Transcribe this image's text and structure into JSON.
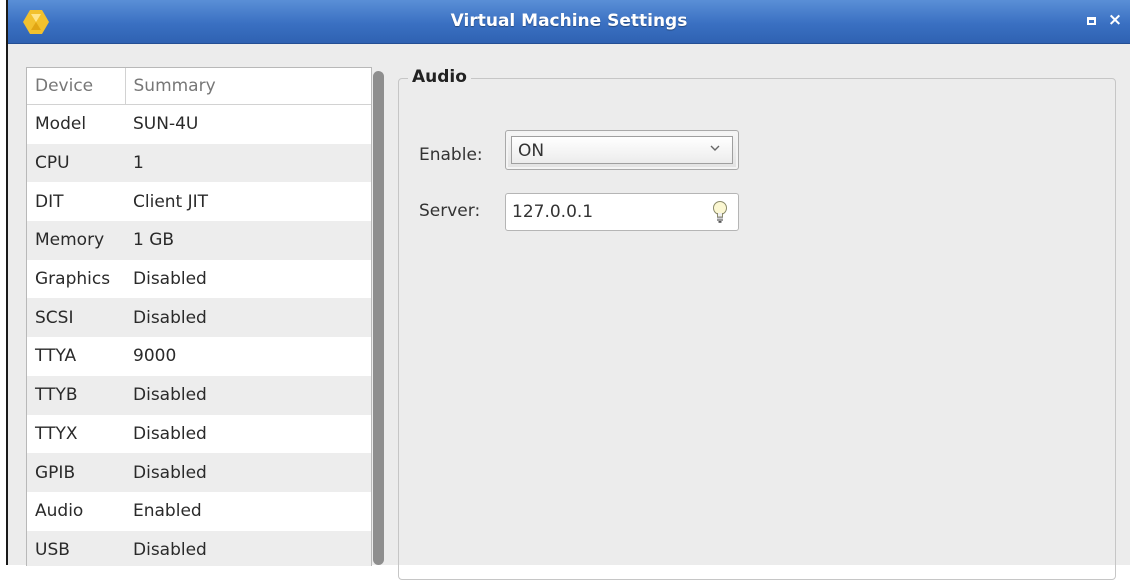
{
  "window": {
    "title": "Virtual Machine Settings",
    "maximize_icon": "maximize-icon",
    "close_symbol": "×"
  },
  "devices": {
    "headers": {
      "device": "Device",
      "summary": "Summary"
    },
    "rows": [
      {
        "device": "Model",
        "summary": "SUN-4U"
      },
      {
        "device": "CPU",
        "summary": "1"
      },
      {
        "device": "DIT",
        "summary": "Client JIT"
      },
      {
        "device": "Memory",
        "summary": "1 GB"
      },
      {
        "device": "Graphics",
        "summary": "Disabled"
      },
      {
        "device": "SCSI",
        "summary": "Disabled"
      },
      {
        "device": "TTYA",
        "summary": "9000"
      },
      {
        "device": "TTYB",
        "summary": "Disabled"
      },
      {
        "device": "TTYX",
        "summary": "Disabled"
      },
      {
        "device": "GPIB",
        "summary": "Disabled"
      },
      {
        "device": "Audio",
        "summary": "Enabled"
      },
      {
        "device": "USB",
        "summary": "Disabled"
      }
    ]
  },
  "audio": {
    "group_title": "Audio",
    "enable_label": "Enable:",
    "enable_value": "ON",
    "server_label": "Server:",
    "server_value": "127.0.0.1"
  },
  "colors": {
    "titlebar": "#3a70c2",
    "window_bg": "#ececec",
    "row_alt": "#ededed"
  }
}
